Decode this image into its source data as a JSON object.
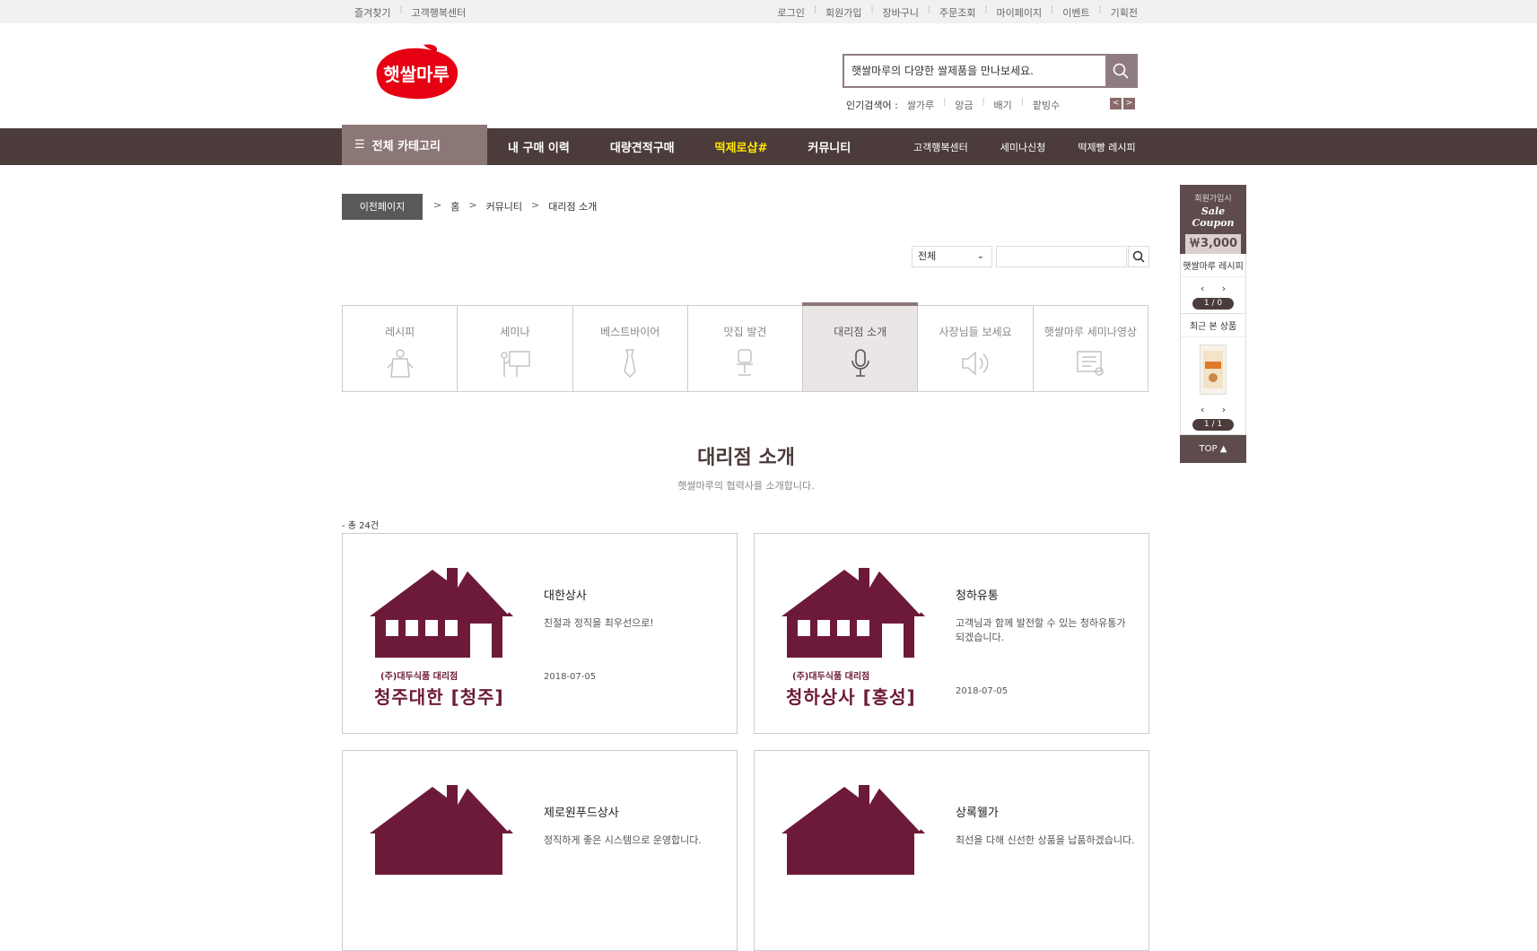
{
  "topbar": {
    "left": [
      "즐겨찾기",
      "고객행복센터"
    ],
    "right": [
      "로그인",
      "회원가입",
      "장바구니",
      "주문조회",
      "마이페이지",
      "이벤트",
      "기획전"
    ]
  },
  "logo": {
    "text": "햇쌀마루"
  },
  "search": {
    "placeholder": "햇쌀마루의 다양한 쌀제품을 만나보세요."
  },
  "popular": {
    "label": "인기검색어 :",
    "terms": [
      "쌀가루",
      "앙금",
      "배기",
      "팥빙수"
    ]
  },
  "nav": {
    "category": "전체 카테고리",
    "items": [
      "내 구매 이력",
      "대량견적구매",
      "떡제로샵#",
      "커뮤니티"
    ],
    "right": [
      "고객행복센터",
      "세미나신청",
      "떡제빵 레시피"
    ]
  },
  "breadcrumb": {
    "prev": "이전페이지",
    "items": [
      "홈",
      "커뮤니티",
      "대리점 소개"
    ]
  },
  "filter": {
    "selected": "전체"
  },
  "tabs": [
    "레시피",
    "세미나",
    "베스트바이어",
    "맛집 발견",
    "대리점 소개",
    "사장님들 보세요",
    "햇쌀마루 세미나영상"
  ],
  "page": {
    "title": "대리점 소개",
    "subtitle": "햇쌀마루의 협력사를 소개합니다.",
    "count": "- 총 24건"
  },
  "cards": [
    {
      "name": "대한상사",
      "desc": "친절과 정직을 최우선으로!",
      "date": "2018-07-05",
      "thumb_small": "(주)대두식품 대리점",
      "thumb_big": "청주대한 [청주]"
    },
    {
      "name": "청하유통",
      "desc": "고객님과 함께 발전할 수 있는 청하유통가 되겠습니다.",
      "date": "2018-07-05",
      "thumb_small": "(주)대두식품 대리점",
      "thumb_big": "청하상사 [홍성]"
    },
    {
      "name": "제로원푸드상사",
      "desc": "정직하게 좋은 시스템으로 운영합니다.",
      "date": "",
      "thumb_small": "",
      "thumb_big": ""
    },
    {
      "name": "상록웰가",
      "desc": "최선을 다해 신선한 상품을 납품하겠습니다.",
      "date": "",
      "thumb_small": "",
      "thumb_big": ""
    }
  ],
  "sidebar": {
    "coupon_line1": "회원가입시",
    "coupon_line2": "Sale Coupon",
    "coupon_amount": "￦3,000",
    "recipe_title": "햇쌀마루 레시피",
    "recipe_arrows": "‹ ›",
    "recipe_page": "1 / 0",
    "recent_title": "최근 본 상품",
    "recent_arrows": "‹ ›",
    "recent_page": "1 / 1",
    "top": "TOP ▲"
  },
  "colors": {
    "brand": "#4b3c3b",
    "accent": "#8c7777",
    "highlight": "#ffe600",
    "house": "#6d1a3a"
  }
}
